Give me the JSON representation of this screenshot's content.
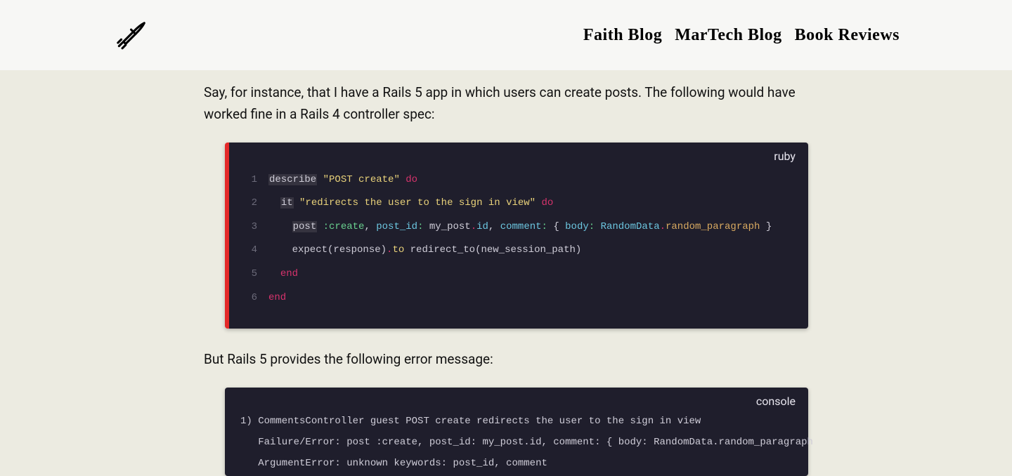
{
  "nav": {
    "items": [
      {
        "label": "Faith Blog"
      },
      {
        "label": "MarTech Blog"
      },
      {
        "label": "Book Reviews"
      }
    ]
  },
  "article": {
    "para1": "Say, for instance, that I have a Rails 5 app in which users can create posts. The following would have worked fine in a Rails 4 controller spec:",
    "para2": "But Rails 5 provides the following error message:"
  },
  "code1": {
    "lang": "ruby",
    "lines": [
      {
        "n": "1",
        "tokens": [
          [
            "kw",
            "describe"
          ],
          [
            "plain",
            " "
          ],
          [
            "str",
            "\"POST create\""
          ],
          [
            "plain",
            " "
          ],
          [
            "do",
            "do"
          ]
        ]
      },
      {
        "n": "2",
        "tokens": [
          [
            "plain",
            "  "
          ],
          [
            "kw",
            "it"
          ],
          [
            "plain",
            " "
          ],
          [
            "str",
            "\"redirects the user to the sign in view\""
          ],
          [
            "plain",
            " "
          ],
          [
            "do",
            "do"
          ]
        ]
      },
      {
        "n": "3",
        "tokens": [
          [
            "plain",
            "    "
          ],
          [
            "kw",
            "post"
          ],
          [
            "plain",
            " "
          ],
          [
            "sym",
            ":create"
          ],
          [
            "plain",
            ", "
          ],
          [
            "id",
            "post_id"
          ],
          [
            "colon",
            ":"
          ],
          [
            "plain",
            " "
          ],
          [
            "plain",
            "my_post"
          ],
          [
            "dot",
            "."
          ],
          [
            "id",
            "id"
          ],
          [
            "plain",
            ", "
          ],
          [
            "id",
            "comment"
          ],
          [
            "colon",
            ":"
          ],
          [
            "plain",
            " { "
          ],
          [
            "id",
            "body"
          ],
          [
            "colon",
            ":"
          ],
          [
            "plain",
            " "
          ],
          [
            "const",
            "RandomData"
          ],
          [
            "dot",
            "."
          ],
          [
            "meth",
            "random_paragraph"
          ],
          [
            "plain",
            " }"
          ]
        ]
      },
      {
        "n": "4",
        "tokens": [
          [
            "plain",
            "    expect(response)"
          ],
          [
            "dot",
            "."
          ],
          [
            "to",
            "to"
          ],
          [
            "plain",
            " redirect_to(new_session_path)"
          ]
        ]
      },
      {
        "n": "5",
        "tokens": [
          [
            "plain",
            "  "
          ],
          [
            "do",
            "end"
          ]
        ]
      },
      {
        "n": "6",
        "tokens": [
          [
            "do",
            "end"
          ]
        ]
      }
    ]
  },
  "console1": {
    "lang": "console",
    "lines": [
      "1) CommentsController guest POST create redirects the user to the sign in view",
      "   Failure/Error: post :create, post_id: my_post.id, comment: { body: RandomData.random_paragraph",
      "   ArgumentError: unknown keywords: post_id, comment"
    ]
  }
}
